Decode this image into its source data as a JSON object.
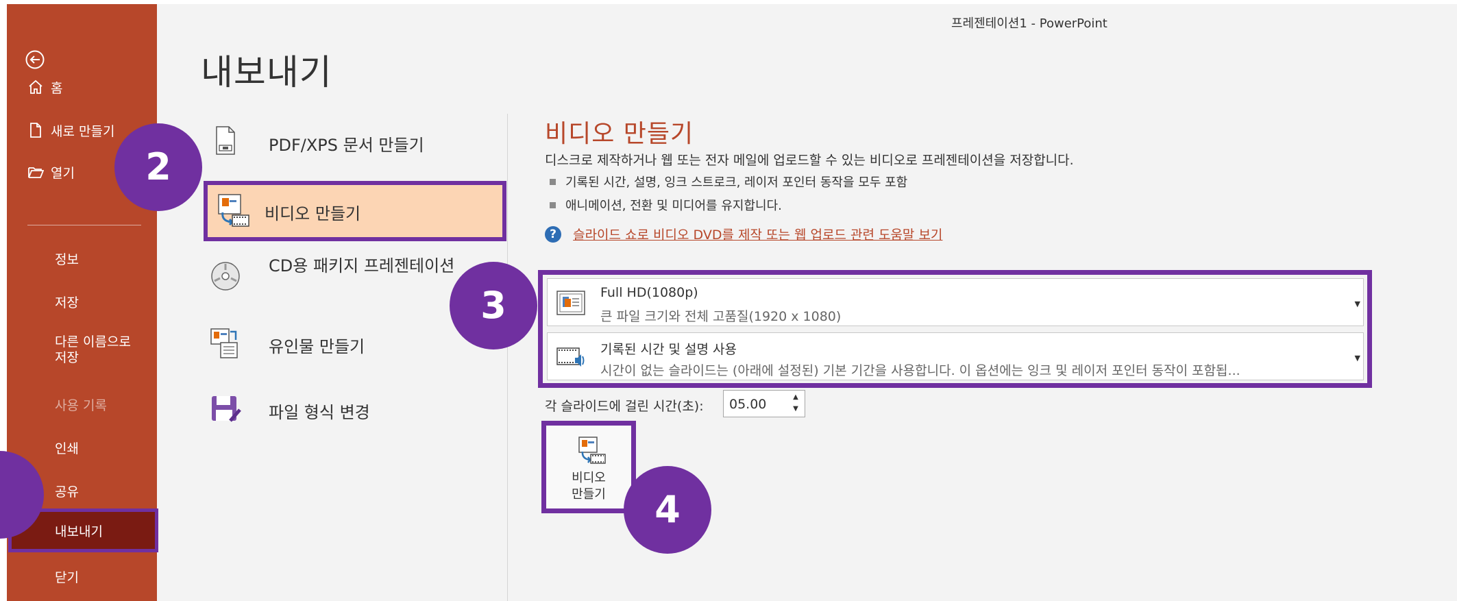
{
  "window": {
    "title": "프레젠테이션1  -  PowerPoint"
  },
  "nav": {
    "back_label": "",
    "items": [
      {
        "label": "홈",
        "icon": "home-icon"
      },
      {
        "label": "새로 만들기",
        "icon": "new-document-icon"
      },
      {
        "label": "열기",
        "icon": "open-folder-icon"
      },
      {
        "label": "정보"
      },
      {
        "label": "저장"
      },
      {
        "label": "다른 이름으로 저장"
      },
      {
        "label": "사용 기록",
        "disabled": true
      },
      {
        "label": "인쇄"
      },
      {
        "label": "공유"
      },
      {
        "label": "내보내기",
        "selected": true
      },
      {
        "label": "닫기"
      }
    ]
  },
  "page_title": "내보내기",
  "export_options": [
    {
      "label": "PDF/XPS 문서 만들기",
      "icon": "pdf-document-icon"
    },
    {
      "label": "비디오 만들기",
      "icon": "video-icon",
      "selected": true
    },
    {
      "label": "CD용 패키지 프레젠테이션",
      "icon": "cd-icon"
    },
    {
      "label": "유인물 만들기",
      "icon": "handout-icon"
    },
    {
      "label": "파일 형식 변경",
      "icon": "save-as-floppy-icon"
    }
  ],
  "detail": {
    "title": "비디오 만들기",
    "description": "디스크로 제작하거나 웹 또는 전자 메일에 업로드할 수 있는 비디오로 프레젠테이션을 저장합니다.",
    "bullets": [
      "기록된 시간, 설명, 잉크 스트로크, 레이저 포인터 동작을 모두 포함",
      "애니메이션, 전환 및 미디어를 유지합니다."
    ],
    "help_link": "슬라이드 쇼로 비디오 DVD를 제작 또는 웹 업로드 관련 도움말 보기",
    "quality_dropdown": {
      "title": "Full HD(1080p)",
      "subtitle": "큰 파일 크기와 전체 고품질(1920 x 1080)"
    },
    "timing_dropdown": {
      "title": "기록된 시간 및 설명 사용",
      "subtitle": "시간이 없는 슬라이드는 (아래에 설정된) 기본 기간을 사용합니다. 이 옵션에는 잉크 및 레이저 포인터 동작이 포함됩..."
    },
    "seconds_label": "각 슬라이드에 걸린 시간(초):",
    "seconds_value": "05.00",
    "create_button": "비디오\n만들기"
  },
  "steps": [
    "2",
    "3",
    "4"
  ],
  "colors": {
    "backstage_nav": "#b7472a",
    "highlight_border": "#7030a0",
    "selected_option_bg": "#fcd5b4",
    "selected_nav_bg": "#7a1b12",
    "step_marker": "#7030a0"
  }
}
